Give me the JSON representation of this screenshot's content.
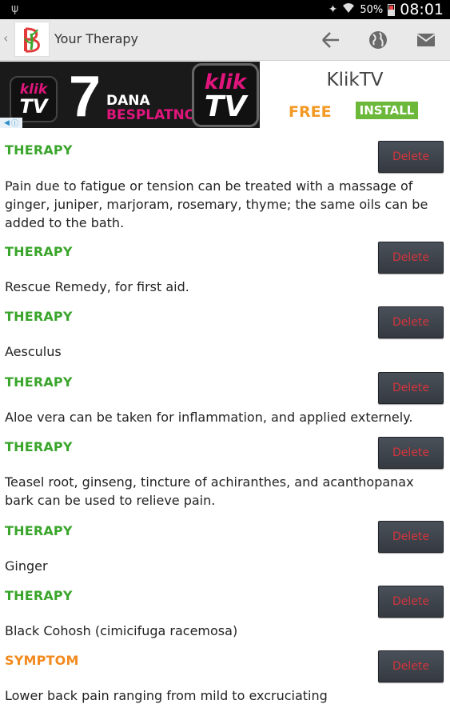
{
  "status_bar": {
    "battery_text": "50%",
    "battery_level": 0.5,
    "time": "08:01"
  },
  "action_bar": {
    "title": "Your Therapy",
    "icons": [
      "back-arrow-icon",
      "globe-icon",
      "mail-icon"
    ]
  },
  "ad": {
    "brand_small": "klik",
    "brand_tv": "TV",
    "big_number": "7",
    "dana": "DANA",
    "besplatno": "BESPLATNO",
    "app_name": "KlikTV",
    "free_label": "FREE",
    "install_label": "INSTALL"
  },
  "entries": [
    {
      "type": "THERAPY",
      "text": "Pain due to fatigue or tension can be treated with a massage of ginger, juniper, marjoram, rosemary, thyme; the same oils can be added to the bath."
    },
    {
      "type": "THERAPY",
      "text": "Rescue Remedy, for first aid."
    },
    {
      "type": "THERAPY",
      "text": "Aesculus"
    },
    {
      "type": "THERAPY",
      "text": "Aloe vera can be taken for inflammation, and applied externely."
    },
    {
      "type": "THERAPY",
      "text": "Teasel root, ginseng, tincture of achiranthes, and acanthopanax bark can be used to relieve pain."
    },
    {
      "type": "THERAPY",
      "text": " Ginger"
    },
    {
      "type": "THERAPY",
      "text": "Black Cohosh (cimicifuga racemosa)"
    },
    {
      "type": "SYMPTOM",
      "text": "Lower back pain ranging from mild to excruciating"
    }
  ],
  "delete_label": "Delete",
  "colors": {
    "therapy": "#3aa52b",
    "symptom": "#f28a1e",
    "delete_text": "#d3343d"
  }
}
